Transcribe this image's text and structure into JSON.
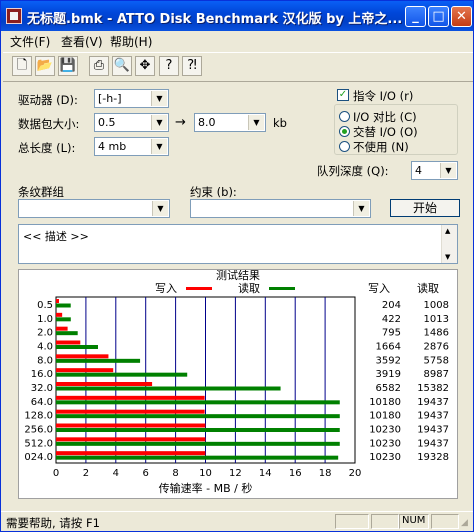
{
  "window": {
    "title": "无标题.bmk - ATTO Disk Benchmark 汉化版 by 上帝之...",
    "minimize_glyph": "_",
    "maximize_glyph": "□",
    "close_glyph": "✕"
  },
  "menu": [
    "文件(F)",
    "查看(V)",
    "帮助(H)"
  ],
  "toolbar_icons": [
    "new-document-icon",
    "open-folder-icon",
    "save-disk-icon",
    "print-icon",
    "print-preview-icon",
    "move-arrows-icon",
    "help-icon",
    "context-help-icon"
  ],
  "form": {
    "drive_label": "驱动器 (D):",
    "drive_value": "[-h-]",
    "transfer_label": "数据包大小:",
    "transfer_from": "0.5",
    "transfer_arrow": "→",
    "transfer_to": "8.0",
    "transfer_unit": "kb",
    "length_label": "总长度 (L):",
    "length_value": "4 mb",
    "stripe_label": "条纹群组",
    "stripe_value": "",
    "constraint_label": "约束 (b):",
    "constraint_value": "",
    "queue_label": "队列深度 (Q):",
    "queue_value": "4",
    "direct_io_label": "指令 I/O (r)",
    "direct_io_checked": true,
    "io_compare_label": "I/O 对比 (C)",
    "overlapped_io_label": "交替 I/O (O)",
    "neither_label": "不使用 (N)",
    "selected_mode": "overlapped",
    "start_button": "开始",
    "description": "<< 描述 >>"
  },
  "chart_data": {
    "type": "bar",
    "title": "测试结果",
    "xlabel": "传输速率 - MB / 秒",
    "xlim": [
      0,
      20
    ],
    "xticks": [
      "0",
      "2",
      "4",
      "6",
      "8",
      "10",
      "12",
      "14",
      "16",
      "18",
      "20"
    ],
    "categories": [
      "0.5",
      "1.0",
      "2.0",
      "4.0",
      "8.0",
      "16.0",
      "32.0",
      "64.0",
      "128.0",
      "256.0",
      "512.0",
      "024.0"
    ],
    "series": [
      {
        "name": "写入",
        "color": "#ff0000",
        "values": [
          204,
          422,
          795,
          1664,
          3592,
          3919,
          6582,
          10180,
          10180,
          10230,
          10230,
          10230
        ]
      },
      {
        "name": "读取",
        "color": "#008000",
        "values": [
          1008,
          1013,
          1486,
          2876,
          5758,
          8987,
          15382,
          19437,
          19437,
          19437,
          19437,
          19328
        ]
      }
    ],
    "write_header": "写入",
    "read_header": "读取"
  },
  "status": {
    "text": "需要帮助, 请按 F1",
    "num": "NUM"
  }
}
